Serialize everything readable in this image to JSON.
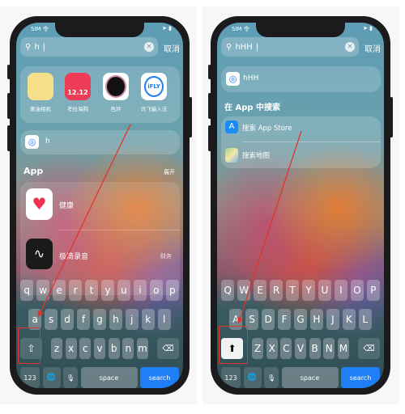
{
  "left": {
    "status_carrier": "SIM 令",
    "search_value": "h",
    "cancel_label": "取消",
    "apps": [
      {
        "label": "黄油相机",
        "color": "#f7e08a"
      },
      {
        "label": "考拉海购",
        "color": "#ee3b56"
      },
      {
        "label": "色环",
        "color": "#222"
      },
      {
        "label": "讯飞输入法",
        "color": "#ffffff"
      }
    ],
    "suggestion": "h",
    "section_title": "App",
    "section_action": "展开",
    "results": [
      {
        "label": "健康",
        "icon": "heart-icon"
      },
      {
        "label": "极简录音",
        "icon": "waveform-icon",
        "tag": "财务"
      }
    ],
    "keys": [
      [
        "q",
        "w",
        "e",
        "r",
        "t",
        "y",
        "u",
        "i",
        "o",
        "p"
      ],
      [
        "a",
        "s",
        "d",
        "f",
        "g",
        "h",
        "j",
        "k",
        "l"
      ],
      [
        "z",
        "x",
        "c",
        "v",
        "b",
        "n",
        "m"
      ]
    ],
    "shift_active": false
  },
  "right": {
    "status_carrier": "SIM 令",
    "search_value": "hHH",
    "cancel_label": "取消",
    "suggestion": "hHH",
    "section_title": "在 App 中搜索",
    "results": [
      {
        "label": "搜索 App Store",
        "icon": "app-store-icon"
      },
      {
        "label": "搜索地图",
        "icon": "maps-icon"
      }
    ],
    "keys": [
      [
        "Q",
        "W",
        "E",
        "R",
        "T",
        "Y",
        "U",
        "I",
        "O",
        "P"
      ],
      [
        "A",
        "S",
        "D",
        "F",
        "G",
        "H",
        "J",
        "K",
        "L"
      ],
      [
        "Z",
        "X",
        "C",
        "V",
        "B",
        "N",
        "M"
      ]
    ],
    "shift_active": true
  },
  "keyboard": {
    "numbers": "123",
    "space": "space",
    "search": "search"
  },
  "annotation_color": "#e0342c"
}
